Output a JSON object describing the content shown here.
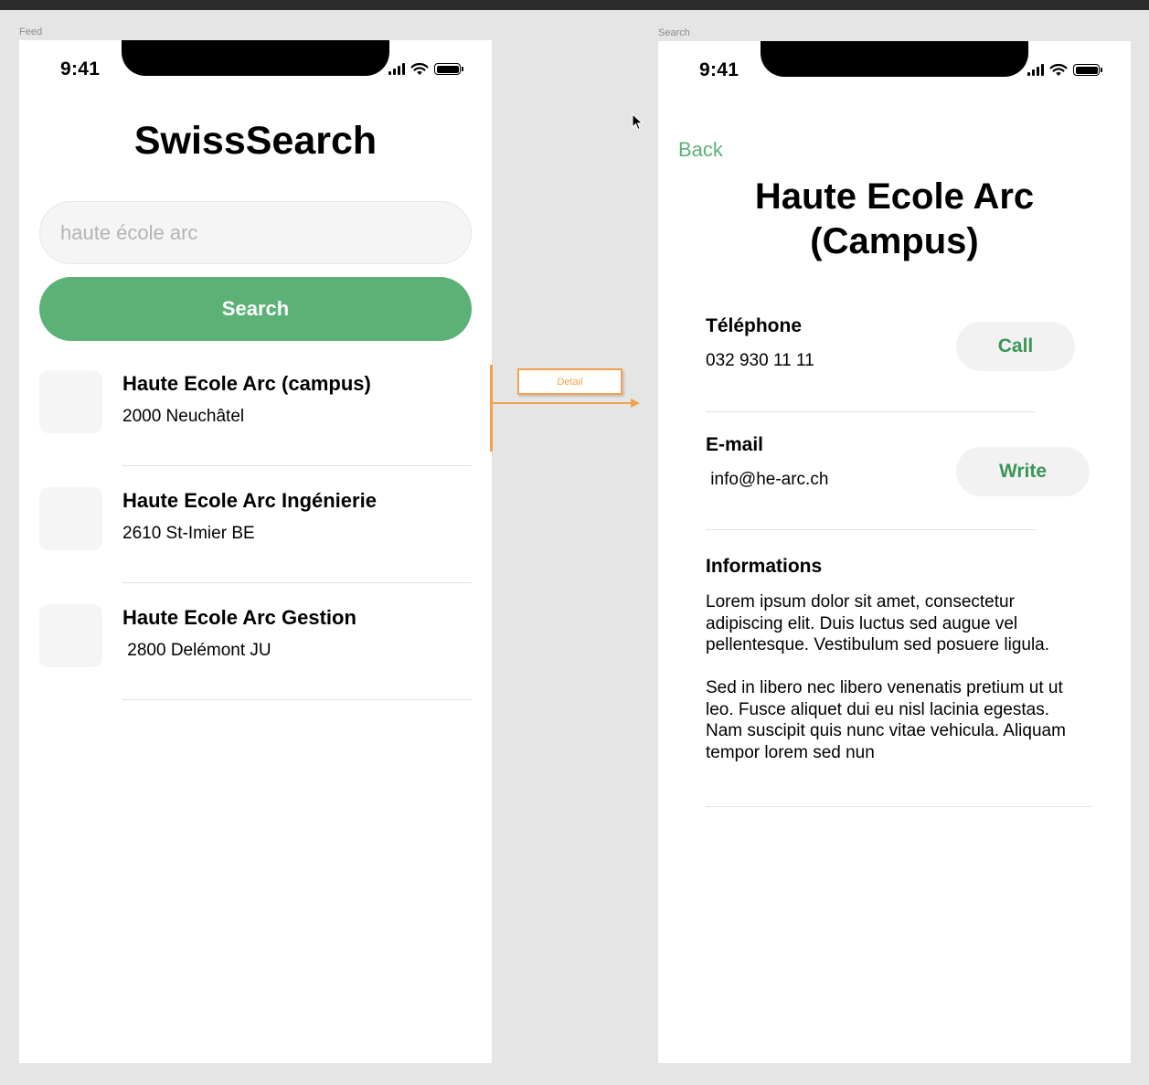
{
  "canvas": {
    "frame_left_label": "Feed",
    "frame_right_label": "Search",
    "connection_label": "Detail"
  },
  "status_bar": {
    "time": "9:41"
  },
  "feed": {
    "app_title": "SwissSearch",
    "search": {
      "placeholder": "haute école arc",
      "value": ""
    },
    "search_button_label": "Search",
    "results": [
      {
        "name": "Haute Ecole Arc (campus)",
        "address": "2000 Neuchâtel"
      },
      {
        "name": "Haute Ecole Arc Ingénierie",
        "address": "2610 St-Imier BE"
      },
      {
        "name": "Haute Ecole Arc Gestion",
        "address": " 2800 Delémont JU"
      }
    ]
  },
  "detail": {
    "back_label": "Back",
    "title": "Haute Ecole Arc (Campus)",
    "phone": {
      "label": "Téléphone",
      "value": "032 930 11 11",
      "action": "Call"
    },
    "email": {
      "label": "E-mail",
      "value": " info@he-arc.ch",
      "action": "Write"
    },
    "info": {
      "label": "Informations",
      "paragraph_1": "Lorem ipsum dolor sit amet, consectetur adipiscing elit. Duis luctus sed augue vel pellentesque. Vestibulum sed posuere ligula.",
      "paragraph_2": "Sed in libero nec libero venenatis pretium ut ut leo. Fusce aliquet dui eu nisl lacinia egestas. Nam suscipit quis nunc vitae vehicula. Aliquam tempor lorem sed nun"
    }
  },
  "colors": {
    "accent_green": "#5cb176",
    "flow_orange": "#f3a14d",
    "canvas_bg": "#e5e5e5"
  },
  "icons": [
    "signal-icon",
    "wifi-icon",
    "battery-icon",
    "cursor-icon"
  ]
}
